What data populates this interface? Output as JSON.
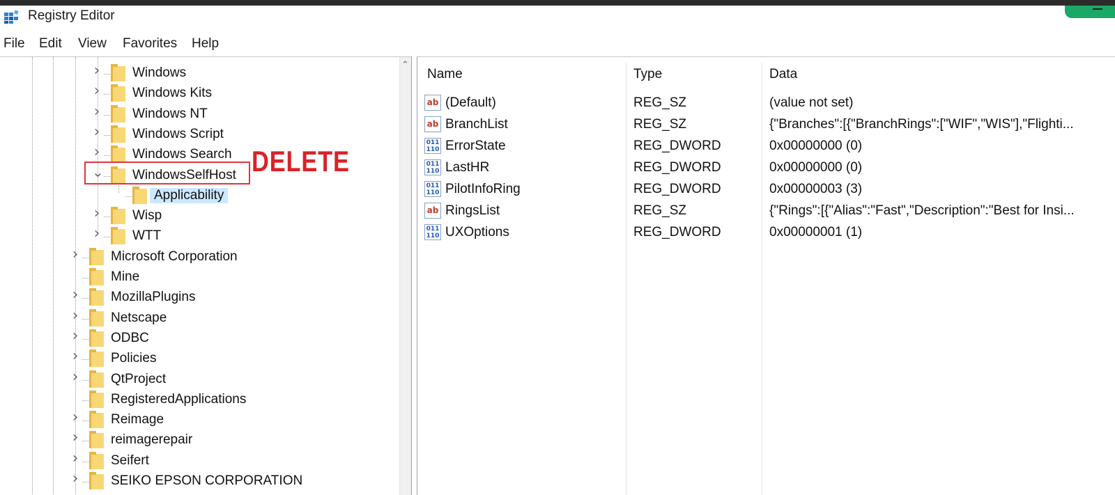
{
  "window": {
    "title": "Registry Editor"
  },
  "menu": [
    "File",
    "Edit",
    "View",
    "Favorites",
    "Help"
  ],
  "tree": {
    "items": [
      {
        "label": "Windows",
        "expander": "collapsed"
      },
      {
        "label": "Windows Kits",
        "expander": "collapsed"
      },
      {
        "label": "Windows NT",
        "expander": "collapsed"
      },
      {
        "label": "Windows Script",
        "expander": "collapsed"
      },
      {
        "label": "Windows Search",
        "expander": "collapsed"
      },
      {
        "label": "WindowsSelfHost",
        "expander": "expanded"
      },
      {
        "label": "Applicability",
        "expander": "none",
        "selected": true
      },
      {
        "label": "Wisp",
        "expander": "collapsed"
      },
      {
        "label": "WTT",
        "expander": "collapsed"
      },
      {
        "label": "Microsoft Corporation",
        "expander": "collapsed"
      },
      {
        "label": "Mine",
        "expander": "none"
      },
      {
        "label": "MozillaPlugins",
        "expander": "collapsed"
      },
      {
        "label": "Netscape",
        "expander": "collapsed"
      },
      {
        "label": "ODBC",
        "expander": "collapsed"
      },
      {
        "label": "Policies",
        "expander": "collapsed"
      },
      {
        "label": "QtProject",
        "expander": "collapsed"
      },
      {
        "label": "RegisteredApplications",
        "expander": "none"
      },
      {
        "label": "Reimage",
        "expander": "collapsed"
      },
      {
        "label": "reimagerepair",
        "expander": "collapsed"
      },
      {
        "label": "Seifert",
        "expander": "collapsed"
      },
      {
        "label": "SEIKO EPSON CORPORATION",
        "expander": "collapsed"
      }
    ]
  },
  "annotation": {
    "text": "DELETE",
    "color": "#d9232a"
  },
  "values_list": {
    "headers": {
      "name": "Name",
      "type": "Type",
      "data": "Data"
    },
    "rows": [
      {
        "icon": "string-value-icon",
        "icon_text": "ab",
        "name": "(Default)",
        "type": "REG_SZ",
        "data": "(value not set)"
      },
      {
        "icon": "string-value-icon",
        "icon_text": "ab",
        "name": "BranchList",
        "type": "REG_SZ",
        "data": "{\"Branches\":[{\"BranchRings\":[\"WIF\",\"WIS\"],\"Flighti..."
      },
      {
        "icon": "binary-value-icon",
        "icon_text": "011 110",
        "name": "ErrorState",
        "type": "REG_DWORD",
        "data": "0x00000000 (0)"
      },
      {
        "icon": "binary-value-icon",
        "icon_text": "011 110",
        "name": "LastHR",
        "type": "REG_DWORD",
        "data": "0x00000000 (0)"
      },
      {
        "icon": "binary-value-icon",
        "icon_text": "011 110",
        "name": "PilotInfoRing",
        "type": "REG_DWORD",
        "data": "0x00000003 (3)"
      },
      {
        "icon": "string-value-icon",
        "icon_text": "ab",
        "name": "RingsList",
        "type": "REG_SZ",
        "data": "{\"Rings\":[{\"Alias\":\"Fast\",\"Description\":\"Best for Insi..."
      },
      {
        "icon": "binary-value-icon",
        "icon_text": "011 110",
        "name": "UXOptions",
        "type": "REG_DWORD",
        "data": "0x00000001 (1)"
      }
    ]
  },
  "colors": {
    "selection": "#cce8ff",
    "folder": "#f8d775",
    "highlight_box": "#e0353a",
    "accent_button": "#19a866"
  }
}
